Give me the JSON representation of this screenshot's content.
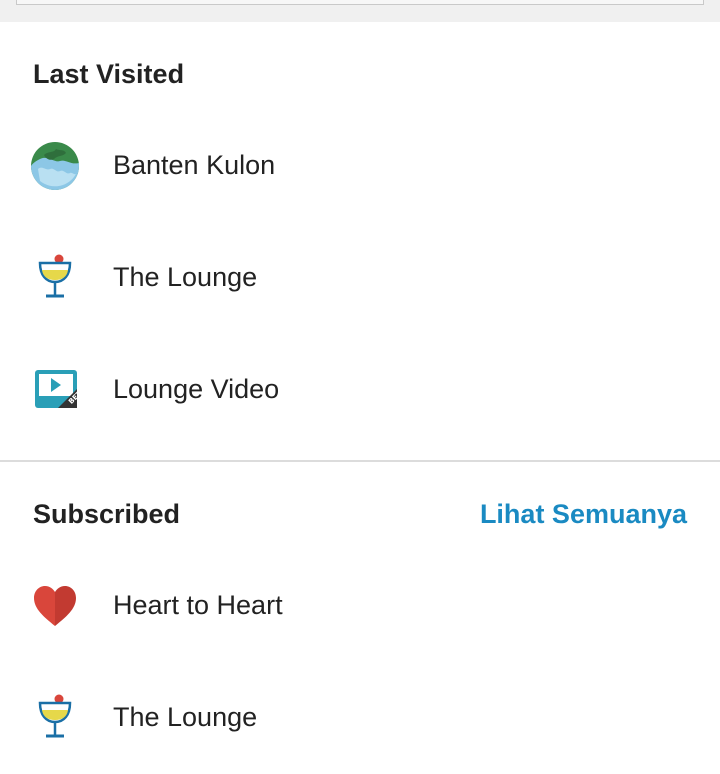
{
  "last_visited": {
    "header": "Last Visited",
    "items": [
      {
        "label": "Banten Kulon",
        "icon": "globe-icon"
      },
      {
        "label": "The Lounge",
        "icon": "cocktail-glass-icon"
      },
      {
        "label": "Lounge Video",
        "icon": "video-play-beta-icon",
        "badge": "BETA"
      }
    ]
  },
  "subscribed": {
    "header": "Subscribed",
    "see_all_label": "Lihat Semuanya",
    "items": [
      {
        "label": "Heart to Heart",
        "icon": "heart-icon"
      },
      {
        "label": "The Lounge",
        "icon": "cocktail-glass-icon"
      }
    ]
  },
  "colors": {
    "accent": "#1a8ac2",
    "text": "#222222",
    "divider": "#dcdcdc"
  }
}
